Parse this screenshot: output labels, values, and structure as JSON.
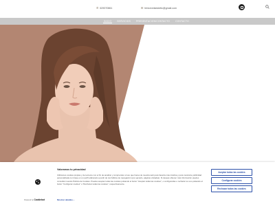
{
  "header": {
    "phone": "629070861",
    "email": "trinicevelaestetic@gmail.com",
    "instagram_icon": "instagram-icon",
    "search_icon": "search-icon"
  },
  "nav": {
    "items": [
      {
        "label": "Inicio",
        "active": true
      },
      {
        "label": "Servicios",
        "active": false
      },
      {
        "label": "Presentacion/Contacto",
        "active": false
      },
      {
        "label": "Contacto",
        "active": false
      }
    ]
  },
  "hero": {
    "accent_color": "#b38672",
    "image": "woman-face-portrait"
  },
  "cookie_banner": {
    "title": "Valoramos tu privacidad",
    "text": "Utilizamos cookies propias y de terceros con el fin de analizar y comprender el uso que haces de nuestra web para hacerla más intuitiva y para mostrarte publicidad personalizada con base en un perfil elaborado a partir de tus hábitos de navegación (por ejemplo, páginas visitadas). Si deseas obtener más información puedes consultar nuestra Política de Cookies. Puedes aceptar todas las cookies pulsando el botón \"Aceptar todas las cookies\", o configurarlas o rechazar su uso pulsando el botón \"Configurar cookies\" o \"Rechazar todas las cookies\", respectivamente.",
    "powered_by": "Powered by",
    "brand": "Cookiebot",
    "details_link": "Mostrar detalles",
    "accept_label": "Aceptar todas las cookies",
    "config_label": "Configurar cookies",
    "reject_label": "Rechazar todas las cookies",
    "button_color": "#2b4fa8"
  }
}
